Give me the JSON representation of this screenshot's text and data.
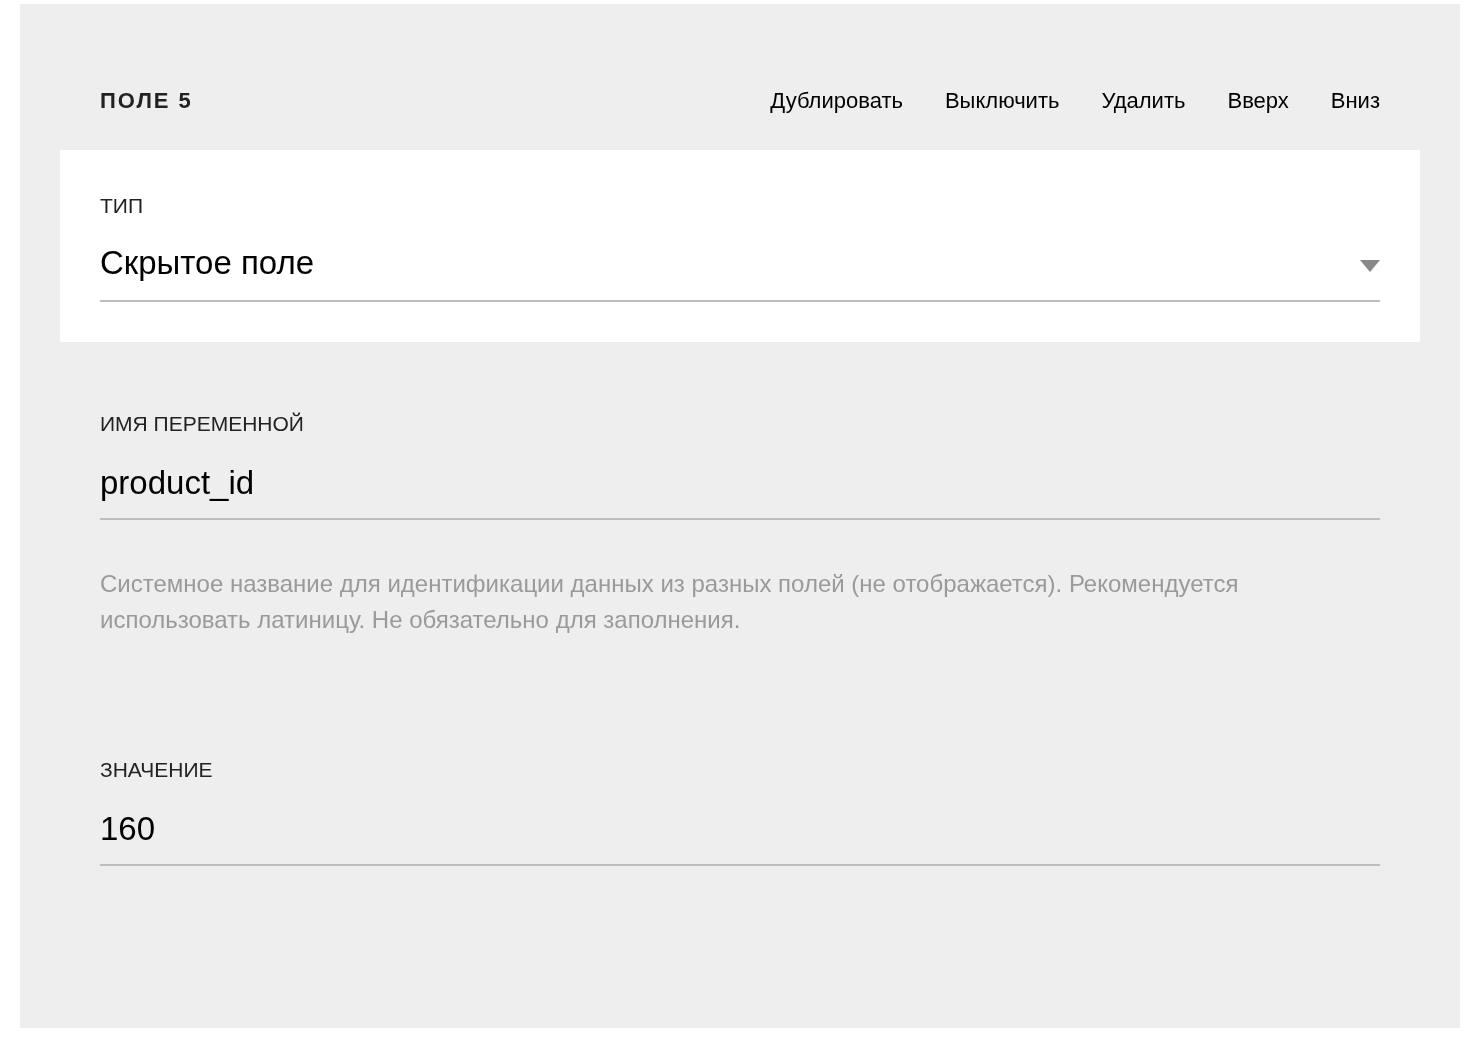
{
  "header": {
    "title": "ПОЛЕ 5",
    "actions": [
      "Дублировать",
      "Выключить",
      "Удалить",
      "Вверх",
      "Вниз"
    ]
  },
  "fields": [
    {
      "kind": "select",
      "label": "ТИП",
      "value": "Скрытое поле"
    },
    {
      "kind": "text",
      "label": "ИМЯ ПЕРЕМЕННОЙ",
      "value": "product_id",
      "hint": "Системное название для идентификации данных из разных полей (не отображается). Рекомендуется использовать латиницу. Не обязательно для заполнения."
    },
    {
      "kind": "text",
      "label": "ЗНАЧЕНИЕ",
      "value": "160"
    }
  ]
}
